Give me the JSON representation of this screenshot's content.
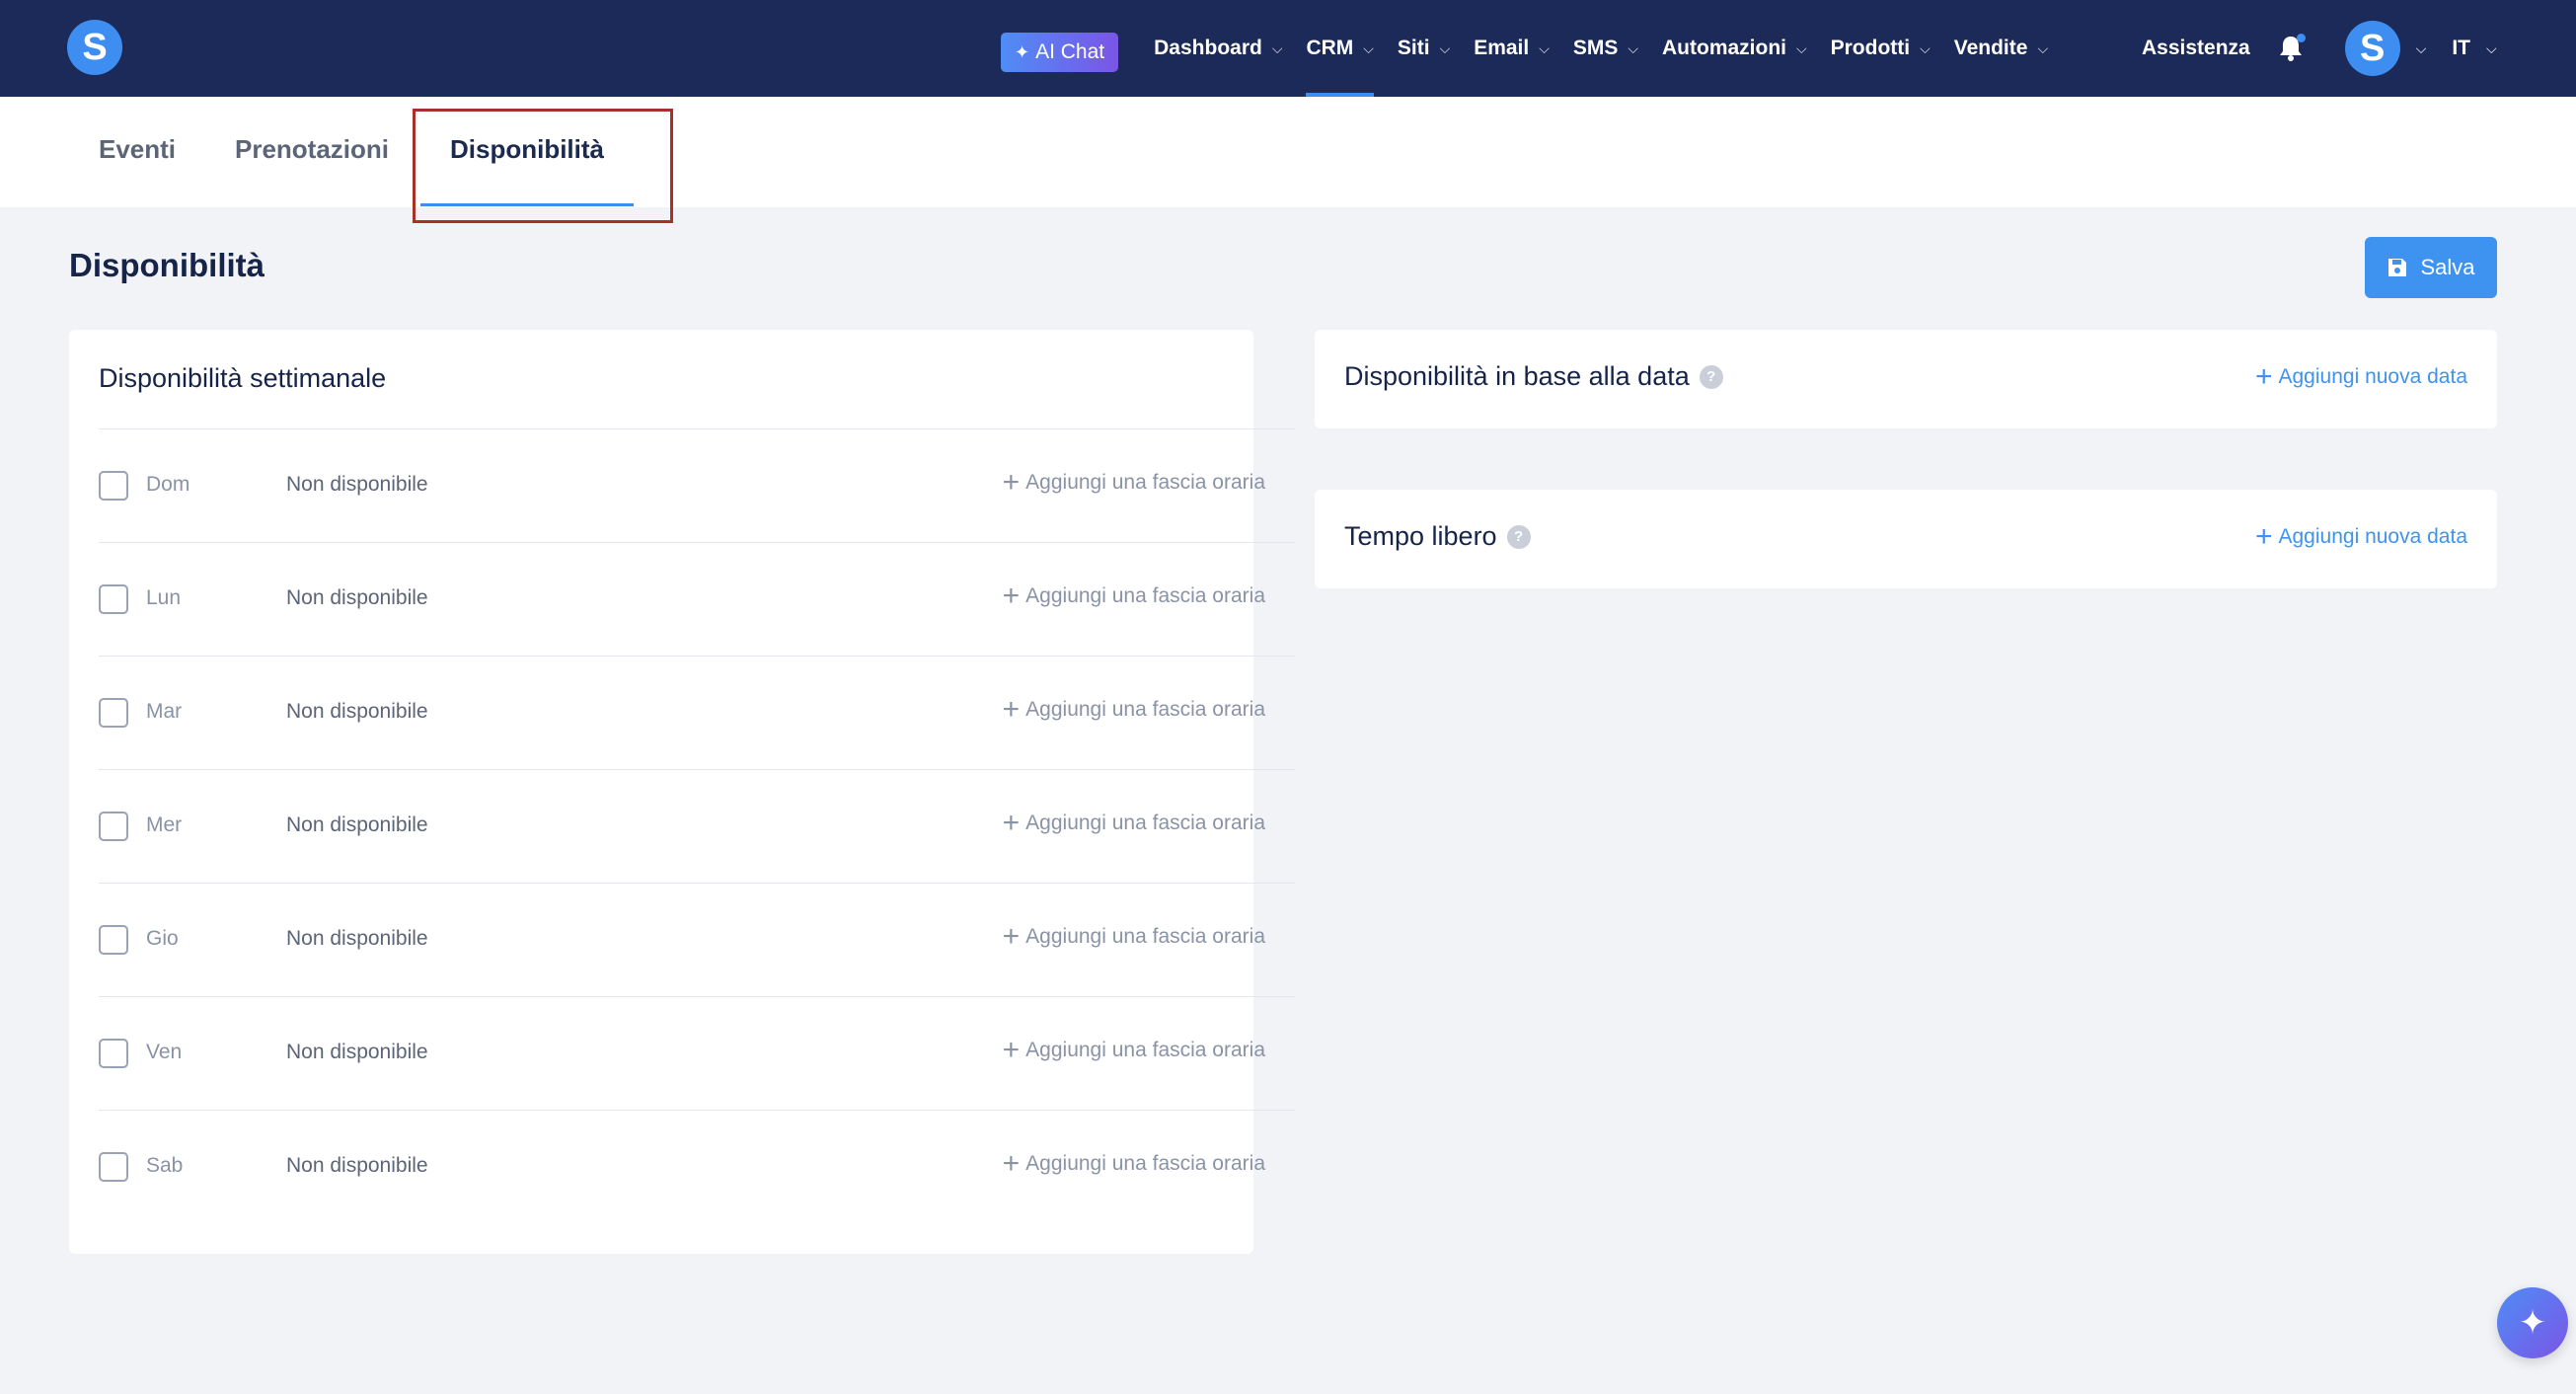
{
  "nav": {
    "logo_letter": "S",
    "ai_chat_label": "AI Chat",
    "items": [
      {
        "label": "Dashboard"
      },
      {
        "label": "CRM"
      },
      {
        "label": "Siti"
      },
      {
        "label": "Email"
      },
      {
        "label": "SMS"
      },
      {
        "label": "Automazioni"
      },
      {
        "label": "Prodotti"
      },
      {
        "label": "Vendite"
      }
    ],
    "active_item": "CRM",
    "help_label": "Assistenza",
    "avatar_letter": "S",
    "language": "IT"
  },
  "tabs": [
    {
      "label": "Eventi"
    },
    {
      "label": "Prenotazioni"
    },
    {
      "label": "Disponibilità"
    }
  ],
  "active_tab": "Disponibilità",
  "page": {
    "title": "Disponibilità",
    "save_label": "Salva"
  },
  "weekly": {
    "title": "Disponibilità settimanale",
    "add_label": "Aggiungi una fascia oraria",
    "days": [
      {
        "day": "Dom",
        "status": "Non disponibile"
      },
      {
        "day": "Lun",
        "status": "Non disponibile"
      },
      {
        "day": "Mar",
        "status": "Non disponibile"
      },
      {
        "day": "Mer",
        "status": "Non disponibile"
      },
      {
        "day": "Gio",
        "status": "Non disponibile"
      },
      {
        "day": "Ven",
        "status": "Non disponibile"
      },
      {
        "day": "Sab",
        "status": "Non disponibile"
      }
    ]
  },
  "date_based": {
    "title": "Disponibilità in base alla data",
    "add_label": "Aggiungi nuova data"
  },
  "free_time": {
    "title": "Tempo libero",
    "add_label": "Aggiungi nuova data"
  },
  "colors": {
    "nav_bg": "#1b2a59",
    "accent": "#3e93f1",
    "highlight_border": "#a8322a"
  }
}
